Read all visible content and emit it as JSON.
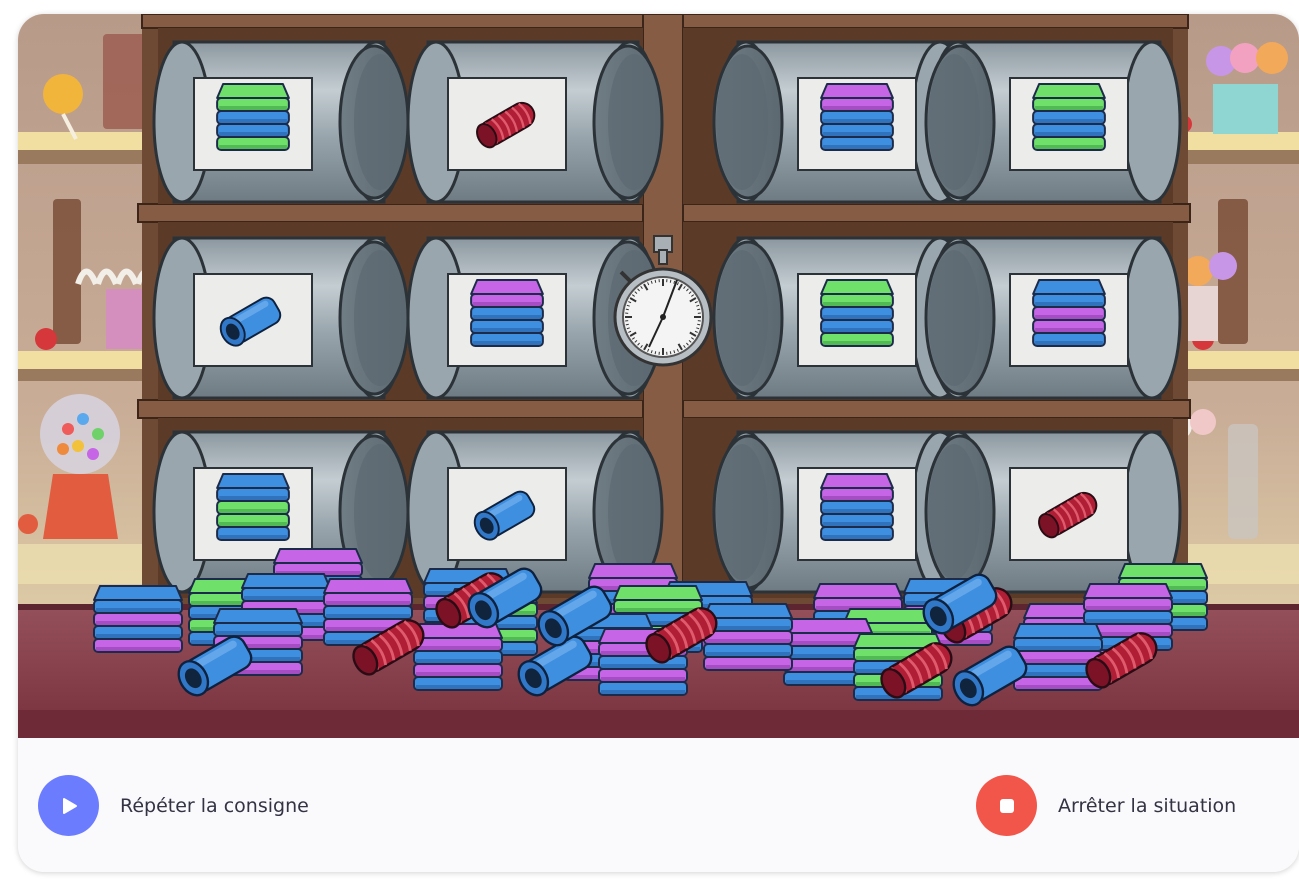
{
  "scene": {
    "description_icon": "candy-shop-shelves",
    "jars": [
      {
        "row": 1,
        "col": 1,
        "candy": "green-blue-layered-cube"
      },
      {
        "row": 1,
        "col": 2,
        "candy": "red-licorice-roll"
      },
      {
        "row": 1,
        "col": 3,
        "candy": "purple-blue-layered-cube"
      },
      {
        "row": 1,
        "col": 4,
        "candy": "green-blue-layered-cube"
      },
      {
        "row": 2,
        "col": 1,
        "candy": "blue-tube"
      },
      {
        "row": 2,
        "col": 2,
        "candy": "purple-blue-layered-cube"
      },
      {
        "row": 2,
        "col": 3,
        "candy": "green-blue-layered-cube"
      },
      {
        "row": 2,
        "col": 4,
        "candy": "blue-purple-layered-cube"
      },
      {
        "row": 3,
        "col": 1,
        "candy": "blue-green-layered-cube"
      },
      {
        "row": 3,
        "col": 2,
        "candy": "blue-tube"
      },
      {
        "row": 3,
        "col": 3,
        "candy": "purple-blue-layered-cube"
      },
      {
        "row": 3,
        "col": 4,
        "candy": "red-licorice-roll"
      }
    ],
    "timer_icon": "stopwatch-icon",
    "colors": {
      "green": "#6fe06a",
      "blue": "#3f8fe0",
      "purple": "#c666e6",
      "red": "#b01e36",
      "wood": "#6e4a35",
      "counter": "#8c3f4c"
    }
  },
  "controls": {
    "repeat_label": "Répéter la consigne",
    "stop_label": "Arrêter la situation"
  }
}
